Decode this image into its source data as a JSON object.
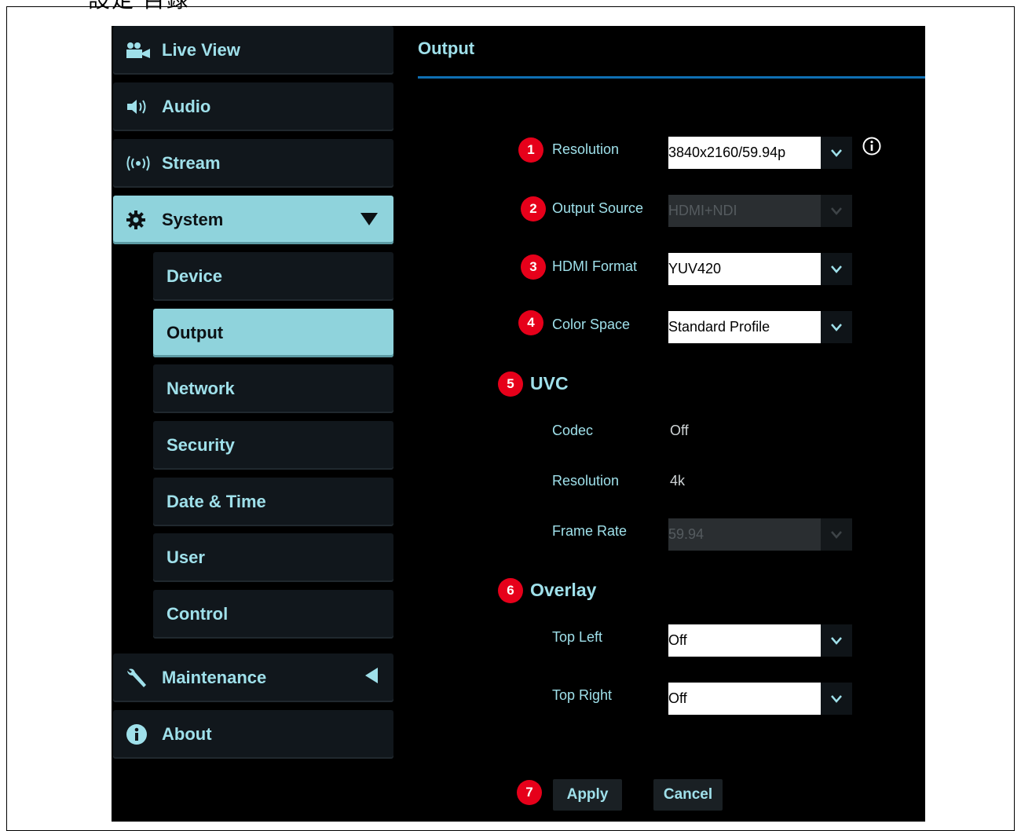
{
  "document": {
    "heading": "設定 目錄"
  },
  "sidebar": {
    "items": [
      {
        "label": "Live View",
        "icon": "camera-icon"
      },
      {
        "label": "Audio",
        "icon": "speaker-icon"
      },
      {
        "label": "Stream",
        "icon": "broadcast-icon"
      },
      {
        "label": "System",
        "icon": "gear-icon",
        "expanded": true
      },
      {
        "label": "Maintenance",
        "icon": "wrench-icon",
        "expanded": false
      },
      {
        "label": "About",
        "icon": "info-icon"
      }
    ],
    "system_sub": [
      "Device",
      "Output",
      "Network",
      "Security",
      "Date & Time",
      "User",
      "Control"
    ],
    "active": "Output"
  },
  "main": {
    "title": "Output",
    "fields": {
      "resolution": {
        "badge": "1",
        "label": "Resolution",
        "value": "3840x2160/59.94p"
      },
      "output_source": {
        "badge": "2",
        "label": "Output Source",
        "value": "HDMI+NDI",
        "disabled": true
      },
      "hdmi_format": {
        "badge": "3",
        "label": "HDMI Format",
        "value": "YUV420"
      },
      "color_space": {
        "badge": "4",
        "label": "Color Space",
        "value": "Standard Profile"
      }
    },
    "uvc": {
      "badge": "5",
      "title": "UVC",
      "codec_label": "Codec",
      "codec_value": "Off",
      "resolution_label": "Resolution",
      "resolution_value": "4k",
      "frame_rate_label": "Frame Rate",
      "frame_rate_value": "59.94"
    },
    "overlay": {
      "badge": "6",
      "title": "Overlay",
      "top_left_label": "Top Left",
      "top_left_value": "Off",
      "top_right_label": "Top Right",
      "top_right_value": "Off"
    },
    "actions": {
      "badge": "7",
      "apply": "Apply",
      "cancel": "Cancel"
    }
  },
  "colors": {
    "accent": "#9fe0ea",
    "active_bg": "#8fd3dc",
    "badge": "#e6001a",
    "title_line": "#0f6fb3"
  }
}
